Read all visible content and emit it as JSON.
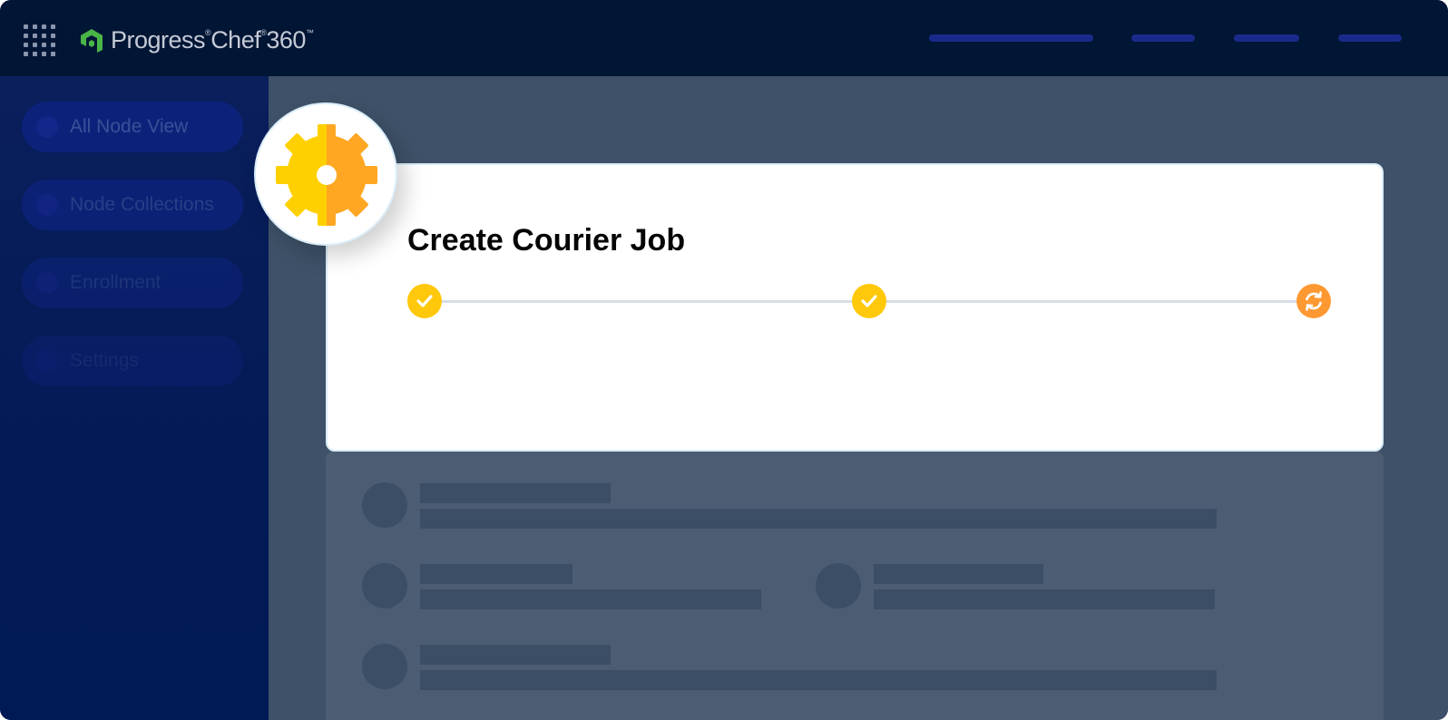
{
  "header": {
    "apps_icon": "grid-apps-icon",
    "logo": {
      "brand": "Progress",
      "product": "Chef",
      "version": "360",
      "registered_mark": "®",
      "trademark": "™"
    },
    "nav_placeholders": [
      "nav-link-1",
      "nav-link-2",
      "nav-link-3",
      "nav-link-4"
    ]
  },
  "sidebar": {
    "items": [
      {
        "label": "All Node View"
      },
      {
        "label": "Node Collections"
      },
      {
        "label": "Enrollment"
      },
      {
        "label": "Settings"
      }
    ]
  },
  "job": {
    "title": "Create Courier Job",
    "icon": "gear-icon",
    "steps": [
      {
        "state": "complete",
        "icon": "check-icon"
      },
      {
        "state": "complete",
        "icon": "check-icon"
      },
      {
        "state": "in-progress",
        "icon": "sync-icon"
      }
    ]
  },
  "colors": {
    "topbar": "#011535",
    "sidebar": "#021a56",
    "main_background": "#3e5168",
    "step_complete": "#ffc80a",
    "step_running": "#fe9932",
    "gear_left": "#ffd000",
    "gear_right": "#ffa722",
    "logo_green": "#49b547"
  }
}
